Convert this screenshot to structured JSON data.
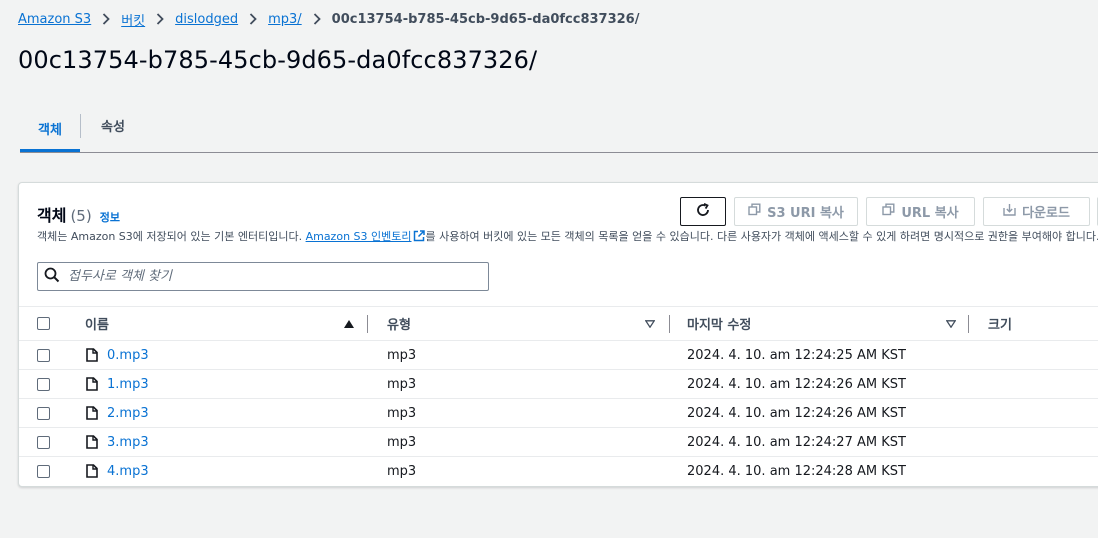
{
  "breadcrumb": {
    "items": [
      "Amazon S3",
      "버킷",
      "dislodged",
      "mp3/"
    ],
    "current": "00c13754-b785-45cb-9d65-da0fcc837326/"
  },
  "page_title": "00c13754-b785-45cb-9d65-da0fcc837326/",
  "tabs": [
    {
      "label": "객체",
      "active": true
    },
    {
      "label": "속성",
      "active": false
    }
  ],
  "objects_panel": {
    "heading": "객체",
    "count": "(5)",
    "info_link": "정보",
    "description_before": "객체는 Amazon S3에 저장되어 있는 기본 엔터티입니다. ",
    "description_link": "Amazon S3 인벤토리",
    "description_after": "를 사용하여 버킷에 있는 모든 객체의 목록을 얻을 수 있습니다. 다른 사용자가 객체에 액세스할 수 있게 하려면 명시적으로 권한을 부여해야 합니다.",
    "buttons": {
      "copy_s3_uri": "S3 URI 복사",
      "copy_url": "URL 복사",
      "download": "다운로드"
    },
    "search_placeholder": "접두사로 객체 찾기"
  },
  "table": {
    "columns": {
      "name": "이름",
      "type": "유형",
      "last_modified": "마지막 수정",
      "size": "크기"
    },
    "rows": [
      {
        "name": "0.mp3",
        "type": "mp3",
        "modified": "2024. 4. 10. am 12:24:25 AM KST"
      },
      {
        "name": "1.mp3",
        "type": "mp3",
        "modified": "2024. 4. 10. am 12:24:26 AM KST"
      },
      {
        "name": "2.mp3",
        "type": "mp3",
        "modified": "2024. 4. 10. am 12:24:26 AM KST"
      },
      {
        "name": "3.mp3",
        "type": "mp3",
        "modified": "2024. 4. 10. am 12:24:27 AM KST"
      },
      {
        "name": "4.mp3",
        "type": "mp3",
        "modified": "2024. 4. 10. am 12:24:28 AM KST"
      }
    ]
  },
  "icons": {
    "breadcrumb_separator": "chevron-right-icon",
    "refresh": "refresh-icon",
    "copy": "copy-icon",
    "download": "download-icon",
    "search": "search-icon",
    "external_link": "external-link-icon",
    "file": "file-icon",
    "sort_ascending": "caret-up-icon",
    "sort_none": "caret-down-icon"
  },
  "colors": {
    "link": "#0972d3",
    "background": "#f2f3f3",
    "text": "#16191f"
  }
}
